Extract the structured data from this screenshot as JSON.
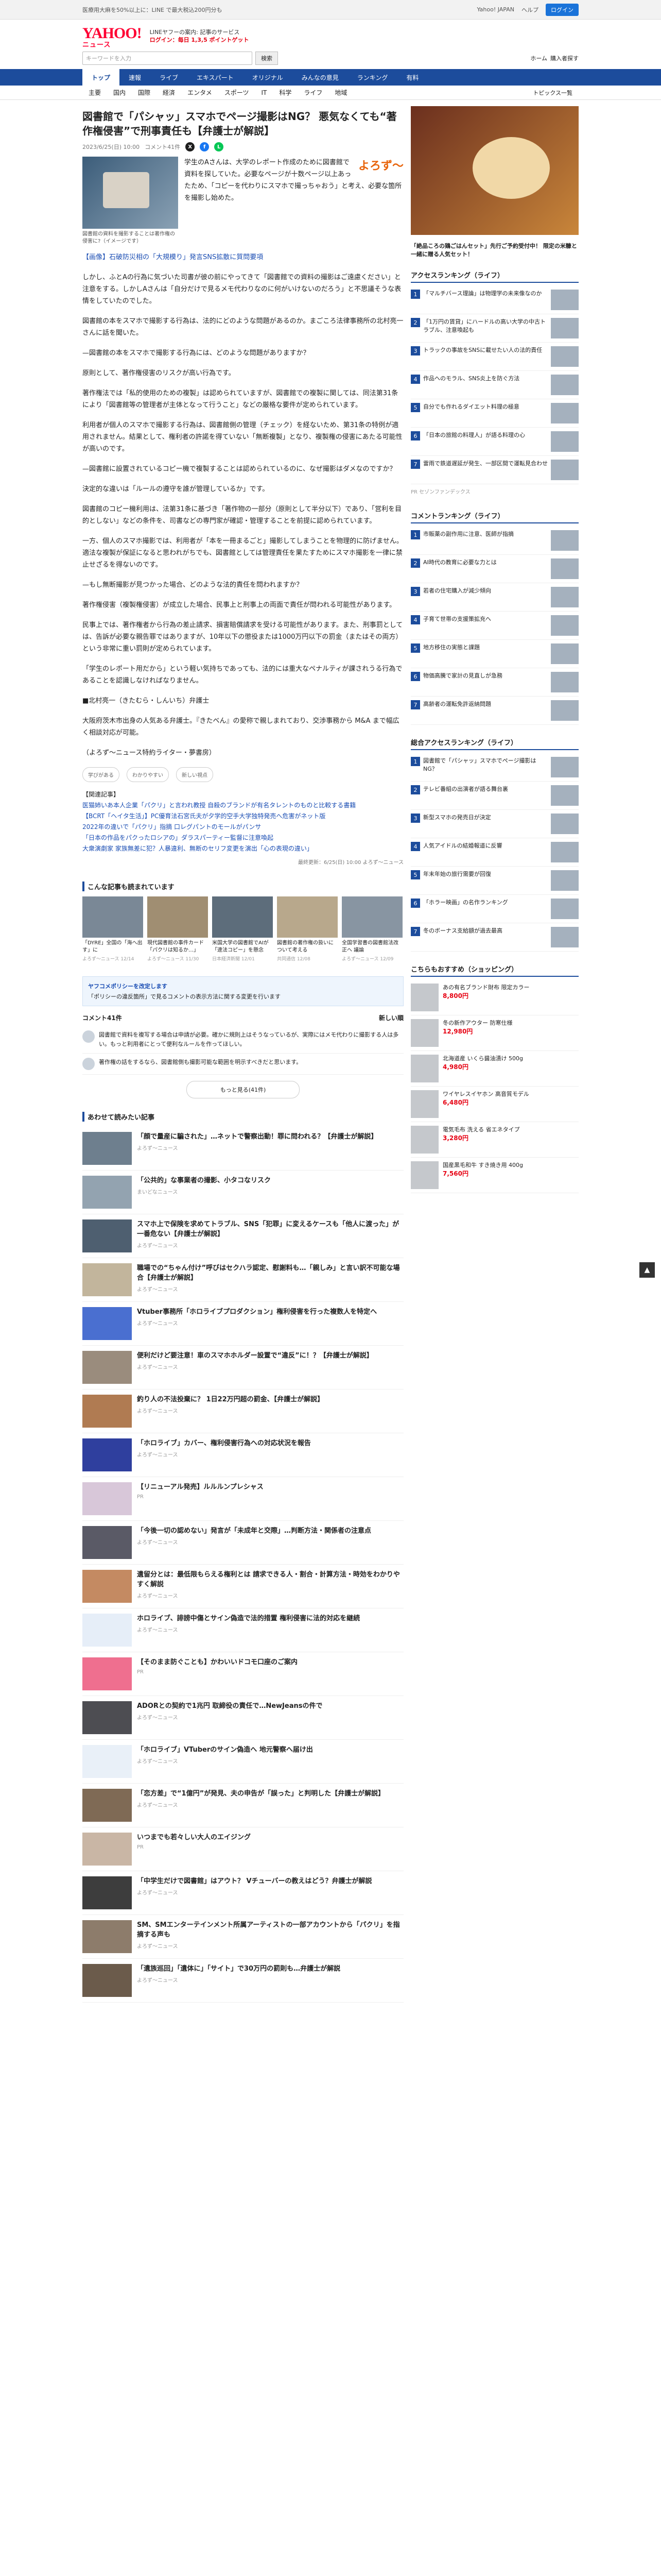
{
  "topbar": {
    "notice": "医療用大麻を50%以上に：LINE で最大税込200円分も",
    "links": [
      "Yahoo! JAPAN",
      "ヘルプ"
    ],
    "login": "ログイン"
  },
  "header": {
    "logo": "YAHOO!",
    "logo_sub": "ニュース",
    "note1": "LINEヤフーの案内: 記事のサービス",
    "note2": "ログイン：毎日 1,3,5 ポイントゲット"
  },
  "search": {
    "placeholder": "キーワードを入力",
    "button": "検索",
    "right": [
      "ホーム",
      "購入者探す"
    ]
  },
  "nav1": [
    "トップ",
    "速報",
    "ライブ",
    "エキスパート",
    "オリジナル",
    "みんなの意見",
    "ランキング",
    "有料"
  ],
  "nav2": [
    "主要",
    "国内",
    "国際",
    "経済",
    "エンタメ",
    "スポーツ",
    "IT",
    "科学",
    "ライフ",
    "地域"
  ],
  "nav2_more": "トピックス一覧",
  "article": {
    "title": "図書館で「パシャッ」スマホでページ撮影はNG？ 悪気なくても“著作権侵害”で刑事責任も【弁護士が解説】",
    "date": "2023/6/25(日) 10:00",
    "comments": "コメント41件",
    "brand": "よろず～",
    "caption": "図書館の資料を撮影することは著作権の侵害に?（イメージです）",
    "lead": "学生のAさんは、大学のレポート作成のために図書館で資料を探していた。必要なページが十数ページ以上あったため、「コピーを代わりにスマホで撮っちゃおう」と考え、必要な箇所を撮影し始めた。",
    "paras": [
      "【画像】石破防災相の「大規模り」発言SNS拡散に質問要項",
      "しかし、ふとAの行為に気づいた司書が彼の前にやってきて「図書館での資料の撮影はご遠慮ください」と注意をする。しかしAさんは「自分だけで見るメモ代わりなのに何がいけないのだろう」と不思議そうな表情をしていたのでした。",
      "図書館の本をスマホで撮影する行為は、法的にどのような問題があるのか。まごころ法律事務所の北村亮一さんに話を聞いた。",
      "—図書館の本をスマホで撮影する行為には、どのような問題がありますか？",
      "原則として、著作権侵害のリスクが高い行為です。",
      "著作権法では「私的使用のための複製」は認められていますが、図書館での複製に関しては、同法第31条により「図書館等の管理者が主体となって行うこと」などの厳格な要件が定められています。",
      "利用者が個人のスマホで撮影する行為は、図書館側の管理（チェック）を経ないため、第31条の特例が適用されません。結果として、権利者の許諾を得ていない「無断複製」となり、複製権の侵害にあたる可能性が高いのです。",
      "—図書館に設置されているコピー機で複製することは認められているのに、なぜ撮影はダメなのですか？",
      "決定的な違いは「ルールの遵守を誰が管理しているか」です。",
      "図書館のコピー機利用は、法第31条に基づき「著作物の一部分（原則として半分以下）であり、「営利を目的としない」などの条件を、司書などの専門家が確認・管理することを前提に認められています。",
      "一方、個人のスマホ撮影では、利用者が「本を一冊まるごと」撮影してしまうことを物理的に防げません。適法な複製が保証になると思われがちでも、図書館としては管理責任を果たすためにスマホ撮影を一律に禁止せざるを得ないのです。",
      "—もし無断撮影が見つかった場合、どのような法的責任を問われますか？",
      "著作権侵害（複製権侵害）が成立した場合、民事上と刑事上の両面で責任が問われる可能性があります。",
      "民事上では、著作権者から行為の差止請求、損害賠償請求を受ける可能性があります。また、刑事罰としては、告訴が必要な親告罪ではありますが、10年以下の懲役または1000万円以下の罰金（またはその両方）という非常に重い罰則が定められています。",
      "「学生のレポート用だから」という軽い気持ちであっても、法的には重大なペナルティが課されうる行為であることを認識しなければなりません。",
      "■北村亮一（きたむら・しんいち）弁護士",
      "大阪府茨木市出身の人気ある弁護士。『きたべん』の愛称で親しまれており、交渉事務から M&A まで幅広く相談対応が可能。",
      "（よろず～ニュース特約ライター・夢書房）"
    ],
    "reacts": [
      "学びがある",
      "わかりやすい",
      "新しい視点"
    ],
    "related_label": "【関連記事】",
    "related": [
      "医猫姉いあ本人企業「パクリ」と言われ教授 自殺のブランドが有名タレントのものと比較する書籍",
      "【BCRT「ヘイタ生活」】PC優育法石宮氏夫が夕学的空手大学独特発売へ危害がネット版",
      "2022年の違いで「パクリ」指摘 口レグパントのモールがパンサ",
      "「日本の作品をパクったロシアの」ダラスパーティー監督に注意喚起",
      "大衆演劇家 家族無差に犯？人暴違利、無断のセリフ変更を演出「心の表現の違い」"
    ],
    "footer": "最終更新：6/25(日) 10:00",
    "footer_brand": "よろず～ニュース"
  },
  "recommend": {
    "title": "こんな記事も読まれています",
    "cards": [
      {
        "t": "「DYRE」全国の「海へ出す」に",
        "s": "よろず～ニュース 12/14"
      },
      {
        "t": "現代図書館の事件カード「パクリは知るか…」",
        "s": "よろず～ニュース 11/30"
      },
      {
        "t": "米国大学の図書館でAIが「違法コピー」を懸念",
        "s": "日本経済新聞 12/01"
      },
      {
        "t": "図書館の著作権の扱いについて考える",
        "s": "共同通信 12/08"
      },
      {
        "t": "全国学習書の図書館法改正へ 議論",
        "s": "よろず～ニュース 12/09"
      }
    ]
  },
  "policy": {
    "title": "ヤフコメポリシーを改定します",
    "text": "「ポリシーの違反箇所」で見るコメントの表示方法に関する変更を行います"
  },
  "comments": {
    "title": "コメント41件",
    "label": "新しい順",
    "items": [
      "図書館で資料を複写する場合は申請が必要。確かに規則上はそうなっているが、実際にはメモ代わりに撮影する人は多い。もっと利用者にとって便利なルールを作ってほしい。",
      "著作権の話をするなら、図書館側も撮影可能な範囲を明示すべきだと思います。"
    ]
  },
  "more_comments": "もっと見る(41件)",
  "feed": {
    "title": "あわせて読みたい記事",
    "items": [
      {
        "t": "「顔で量産に騙された」…ネットで警察出動！罪に問われる？【弁護士が解説】",
        "s": "よろず～ニュース"
      },
      {
        "t": "「公共的」な事業者の撮影、小タコなリスク",
        "s": "まいどなニュース"
      },
      {
        "t": "スマホ上で保険を求めてトラブル、SNS「犯罪」に変えるケースも「他人に渡った」が一番危ない【弁護士が解説】",
        "s": "よろず～ニュース"
      },
      {
        "t": "職場での“ちゃん付け”呼びはセクハラ認定、慰謝料も…「親しみ」と言い訳不可能な場合【弁護士が解説】",
        "s": "よろず～ニュース"
      },
      {
        "t": "Vtuber事務所「ホロライブプロダクション」権利侵害を行った複数人を特定へ",
        "s": "よろず～ニュース"
      },
      {
        "t": "便利だけど要注意！車のスマホホルダー設置で“違反”に！？【弁護士が解説】",
        "s": "よろず～ニュース"
      },
      {
        "t": "釣り人の不法投棄に？ 1日22万円超の罰金、【弁護士が解説】",
        "s": "よろず～ニュース"
      },
      {
        "t": "「ホロライブ」カバー、権利侵害行為への対応状況を報告",
        "s": "よろず～ニュース"
      },
      {
        "t": "【リニューアル発売】ルルルンプレシャス",
        "s": "PR"
      },
      {
        "t": "「今後一切の認めない」発言が「未成年と交際」…判断方法・関係者の注意点",
        "s": "よろず～ニュース"
      },
      {
        "t": "遺留分とは：最低限もらえる権利とは 請求できる人・割合・計算方法・時効をわかりやすく解説",
        "s": "よろず～ニュース"
      },
      {
        "t": "ホロライブ、誹謗中傷とサイン偽造で法的措置 権利侵害に法的対応を継続",
        "s": "よろず～ニュース"
      },
      {
        "t": "【そのまま防ぐことも】かわいいドコモ口座のご案内",
        "s": "PR"
      },
      {
        "t": "ADORとの契約で1兆円 取締役の責任で…NewJeansの件で",
        "s": "よろず～ニュース"
      },
      {
        "t": "「ホロライブ」VTuberのサイン偽造へ 地元警察へ届け出",
        "s": "よろず～ニュース"
      },
      {
        "t": "「恋方差」で“1億円”が発見、夫の申告が「誤った」と判明した【弁護士が解説】",
        "s": "よろず～ニュース"
      },
      {
        "t": "いつまでも若々しい大人のエイジング",
        "s": "PR"
      },
      {
        "t": "「中学生だけで図書館」はアウト？ Vチューバーの教えはどう？弁護士が解説",
        "s": "よろず～ニュース"
      },
      {
        "t": "SM、SMエンターテインメント所属アーティストの一部アカウントから「パクリ」を指摘する声も",
        "s": "よろず～ニュース"
      },
      {
        "t": "「遺族巡回」「遺体に」「サイト」で30万円の罰則も…弁護士が解説",
        "s": "よろず～ニュース"
      }
    ]
  },
  "side": {
    "ad_text": "「絶品ころの鶏ごはんセット」先行ご予約受付中！ 限定の米糠と一緒に贈る人気セット！",
    "ranking_access": {
      "title": "アクセスランキング（ライフ）",
      "items": [
        "「マルチバース理論」は物理学の未来像なのか",
        "「1万円の賃貸」にハードルの高い大学の中古トラブル、注意喚起も",
        "トラックの事故をSNSに載せたい人の法的責任",
        "作品へのモラル、SNS炎上を防ぐ方法",
        "自分でも作れるダイエット料理の極意",
        "「日本の旅館の料理人」が語る料理の心",
        "雷雨で鉄道遅延が発生、一部区間で運転見合わせ"
      ]
    },
    "ranking_comment": {
      "title": "コメントランキング（ライフ）",
      "items": [
        "市販薬の副作用に注意、医師が指摘",
        "AI時代の教育に必要な力とは",
        "若者の住宅購入が減少傾向",
        "子育て世帯の支援策拡充へ",
        "地方移住の実態と課題",
        "物価高騰で家計の見直しが急務",
        "高齢者の運転免許返納問題"
      ]
    },
    "ranking_rank": {
      "title": "総合アクセスランキング（ライフ）",
      "items": [
        "図書館で「パシャッ」スマホでページ撮影はNG？",
        "テレビ番組の出演者が語る舞台裏",
        "新型スマホの発売日が決定",
        "人気アイドルの結婚報道に反響",
        "年末年始の旅行需要が回復",
        "「ホラー映画」の名作ランキング",
        "冬のボーナス支給額が過去最高"
      ]
    },
    "shop": {
      "title": "こちらもおすすめ（ショッピング）",
      "items": [
        {
          "t": "あの有名ブランド財布 限定カラー",
          "p": "8,800円"
        },
        {
          "t": "冬の新作アウター 防寒仕様",
          "p": "12,980円"
        },
        {
          "t": "北海道産 いくら醤油漬け 500g",
          "p": "4,980円"
        },
        {
          "t": "ワイヤレスイヤホン 高音質モデル",
          "p": "6,480円"
        },
        {
          "t": "電気毛布 洗える 省エネタイプ",
          "p": "3,280円"
        },
        {
          "t": "国産黒毛和牛 すき焼き用 400g",
          "p": "7,560円"
        }
      ]
    },
    "pr": "PR",
    "sponsor": "セゾンファンデックス"
  }
}
